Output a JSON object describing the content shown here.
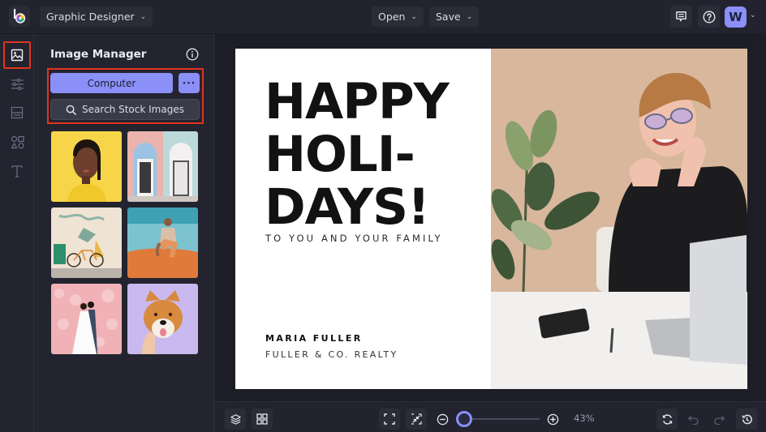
{
  "topbar": {
    "logo": "befunky-logo-icon",
    "mode_label": "Graphic Designer",
    "open_label": "Open",
    "save_label": "Save",
    "avatar_initial": "W"
  },
  "rail": {
    "items": [
      {
        "name": "image-manager",
        "icon": "image-icon",
        "active": true
      },
      {
        "name": "adjust",
        "icon": "sliders-icon",
        "active": false
      },
      {
        "name": "layouts",
        "icon": "layout-icon",
        "active": false
      },
      {
        "name": "graphics",
        "icon": "shapes-icon",
        "active": false
      },
      {
        "name": "text",
        "icon": "text-icon",
        "active": false
      }
    ]
  },
  "panel": {
    "title": "Image Manager",
    "computer_label": "Computer",
    "more_label": "•••",
    "search_label": "Search Stock Images",
    "thumbnails": [
      {
        "subject": "woman portrait yellow"
      },
      {
        "subject": "pastel doors"
      },
      {
        "subject": "mural with bicycle"
      },
      {
        "subject": "man sitting on sand"
      },
      {
        "subject": "wedding couple cherry blossoms"
      },
      {
        "subject": "shiba inu dog"
      }
    ]
  },
  "canvas": {
    "headline_lines": [
      "HAPPY",
      "HOLI-",
      "DAYS!"
    ],
    "subtitle": "TO YOU AND YOUR FAMILY",
    "name": "MARIA FULLER",
    "company": "FULLER & CO. REALTY",
    "photo_subject": "smiling woman with glasses at desk"
  },
  "bottombar": {
    "zoom_percent": 43,
    "zoom_label": "43%"
  },
  "colors": {
    "accent": "#8b8ff8",
    "highlight": "#e0341f",
    "bg": "#23242f"
  }
}
